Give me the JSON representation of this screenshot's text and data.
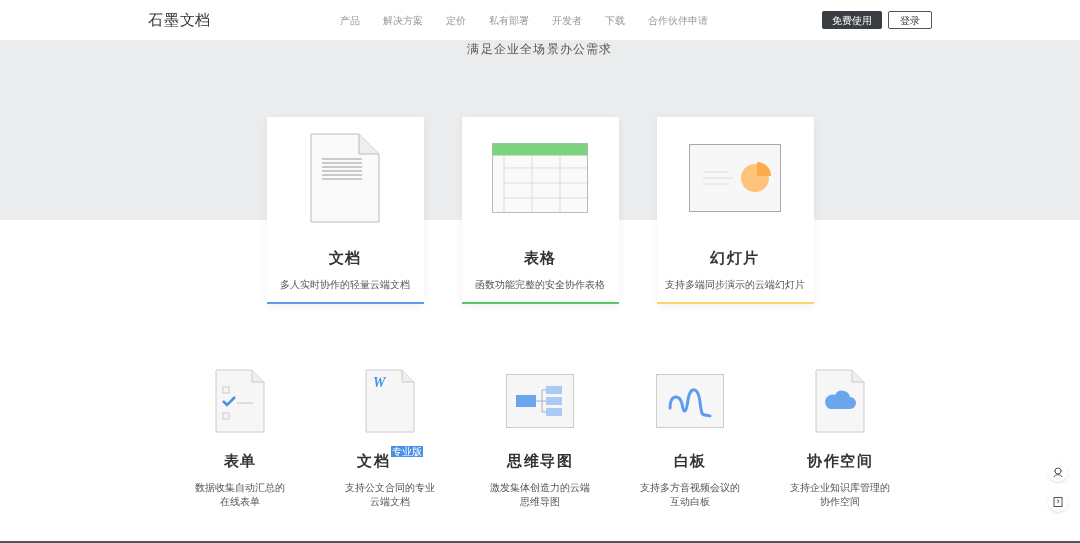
{
  "header": {
    "logo": "石墨文档",
    "nav": [
      {
        "label": "产品"
      },
      {
        "label": "解决方案"
      },
      {
        "label": "定价"
      },
      {
        "label": "私有部署"
      },
      {
        "label": "开发者"
      },
      {
        "label": "下载"
      },
      {
        "label": "合作伙伴申请"
      }
    ],
    "primary_button": "免费使用",
    "login_button": "登录"
  },
  "hero": {
    "subtitle": "满足企业全场景办公需求"
  },
  "main_products": [
    {
      "kind": "doc",
      "title": "文档",
      "description": "多人实时协作的轻量云端文档",
      "color": "#5b9cf0"
    },
    {
      "kind": "sheet",
      "title": "表格",
      "description": "函数功能完整的安全协作表格",
      "color": "#5cc46a"
    },
    {
      "kind": "slides",
      "title": "幻灯片",
      "description": "支持多端同步演示的云端幻灯片",
      "color": "#ffd36b"
    }
  ],
  "more_products": [
    {
      "kind": "form",
      "title": "表单",
      "description": [
        "数据收集自动汇总的",
        "在线表单"
      ]
    },
    {
      "kind": "word",
      "icon_letter": "W",
      "title": "文档",
      "badge": "专业版",
      "description": [
        "支持公文合同的专业",
        "云端文档"
      ]
    },
    {
      "kind": "mindmap",
      "title": "思维导图",
      "description": [
        "激发集体创造力的云端",
        "思维导图"
      ]
    },
    {
      "kind": "whiteboard",
      "title": "白板",
      "description": [
        "支持多方音视频会议的",
        "互动白板"
      ]
    },
    {
      "kind": "space",
      "title": "协作空间",
      "description": [
        "支持企业知识库管理的",
        "协作空间"
      ]
    }
  ]
}
